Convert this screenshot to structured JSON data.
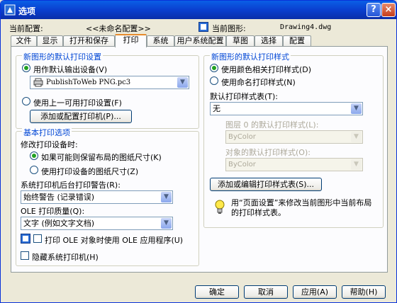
{
  "window": {
    "title": "选项",
    "help": "?",
    "close": "×"
  },
  "info": {
    "profile_label": "当前配置:",
    "profile_value": "<<未命名配置>>",
    "drawing_label": "当前图形:",
    "drawing_value": "Drawing4.dwg"
  },
  "tabs": [
    "文件",
    "显示",
    "打开和保存",
    "打印",
    "系统",
    "用户系统配置",
    "草图",
    "选择",
    "配置"
  ],
  "default_output": {
    "legend": "新图形的默认打印设置",
    "use_default_device": "用作默认输出设备(V)",
    "device_value": "PublishToWeb PNG.pc3",
    "use_last_settings": "使用上一可用打印设置(F)",
    "add_plotter_button": "添加或配置打印机(P)..."
  },
  "general": {
    "legend": "基本打印选项",
    "when_changing": "修改打印设备时:",
    "keep_layout_size": "如果可能则保留布局的图纸尺寸(K)",
    "use_device_size": "使用打印设备的图纸尺寸(Z)",
    "spooler_label": "系统打印机后台打印警告(R):",
    "spooler_value": "始终警告 (记录错误)",
    "ole_quality_label": "OLE 打印质量(Q):",
    "ole_quality_value": "文字 (例如文字文档)",
    "ole_app_checkbox": "打印 OLE 对象时使用 OLE 应用程序(U)",
    "hide_system_printers": "隐藏系统打印机(H)"
  },
  "plot_style": {
    "legend": "新图形的默认打印样式",
    "color_dependent": "使用颜色相关打印样式(D)",
    "named_styles": "使用命名打印样式(N)",
    "default_table_label": "默认打印样式表(T):",
    "default_table_value": "无",
    "layer0_label": "图层 0 的默认打印样式(L):",
    "layer0_value": "ByColor",
    "objects_label": "对象的默认打印样式(O):",
    "objects_value": "ByColor",
    "edit_button": "添加或编辑打印样式表(S)...",
    "tip": "用“页面设置”来修改当前图形中当前布局的打印样式表。"
  },
  "footer": {
    "ok": "确定",
    "cancel": "取消",
    "apply": "应用(A)",
    "help": "帮助(H)"
  }
}
